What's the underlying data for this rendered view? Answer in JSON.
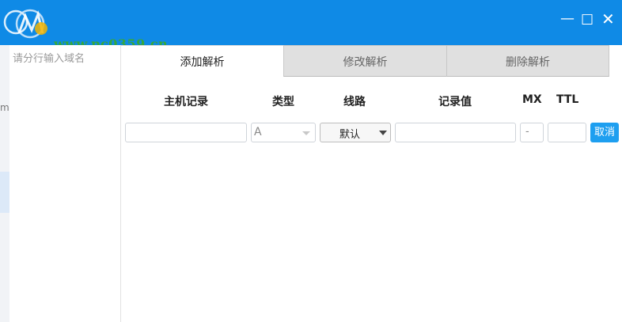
{
  "window": {
    "watermark": "www.pc0359.cn",
    "controls": {
      "minimize": "—",
      "maximize": "☐",
      "close": "✕"
    }
  },
  "left_strip": {
    "clip_text": "m"
  },
  "domain_panel": {
    "placeholder": "请分行输入域名"
  },
  "tabs": [
    {
      "label": "添加解析",
      "active": true
    },
    {
      "label": "修改解析",
      "active": false
    },
    {
      "label": "删除解析",
      "active": false
    }
  ],
  "columns": {
    "host": "主机记录",
    "type": "类型",
    "line": "线路",
    "value": "记录值",
    "mx": "MX",
    "ttl": "TTL"
  },
  "form_row": {
    "host": "",
    "type": "A",
    "line": "默认",
    "value": "",
    "mx": "-",
    "ttl": "",
    "cancel_label": "取消"
  },
  "colors": {
    "titlebar": "#0f8ae6",
    "cancel_button": "#1e9ff0",
    "watermark": "#35a83b"
  }
}
